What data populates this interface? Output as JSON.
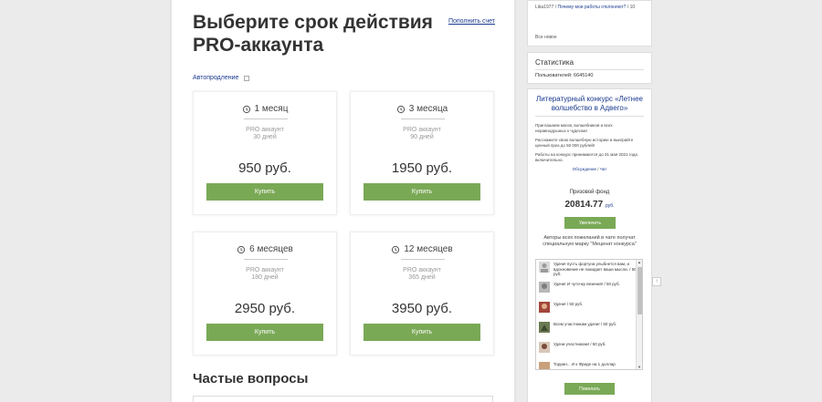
{
  "page": {
    "title": "Выберите срок действия PRO-аккаунта",
    "topup_link": "Пополнить счет",
    "autorenew_label": "Автопродление",
    "faq_title": "Частые вопросы"
  },
  "plans": [
    {
      "duration": "1 месяц",
      "type": "PRO аккаунт",
      "days": "30 дней",
      "price": "950 руб.",
      "buy_label": "Купить"
    },
    {
      "duration": "3 месяца",
      "type": "PRO аккаунт",
      "days": "90 дней",
      "price": "1950 руб.",
      "buy_label": "Купить"
    },
    {
      "duration": "6 месяцев",
      "type": "PRO аккаунт",
      "days": "180 дней",
      "price": "2950 руб.",
      "buy_label": "Купить"
    },
    {
      "duration": "12 месяцев",
      "type": "PRO аккаунт",
      "days": "365 дней",
      "price": "3950 руб.",
      "buy_label": "Купить"
    }
  ],
  "sidebar": {
    "news": {
      "author": "Lika1977",
      "sep1": "/",
      "link": "Почему мои работы отклоняют?",
      "sep2": "/",
      "count": "10",
      "all_news": "Все новое"
    },
    "stats": {
      "title": "Статистика",
      "users": "Пользователей: 6645140"
    },
    "contest": {
      "title": "Литературный конкурс «Летнее волшебство в Адвего»",
      "p1": "Приглашаем магов, волшебников и всех неравнодушных к чудесам!",
      "p2": "Расскажите свою волшебную историю и выиграйте ценный приз до 50 000 рублей!",
      "p3": "Работы на конкурс принимаются до 31 мая 2021 года включительно.",
      "discussion": "Обсуждение",
      "sep": "/",
      "chat": "Чат",
      "prize_label": "Призовой фонд",
      "prize_value": "20814.77",
      "prize_currency": "руб.",
      "increase_label": "Увеличить",
      "authors_note": "Авторы всех пожеланий в чате получат специальную марку \"Меценат конкурса\"",
      "wishes": [
        {
          "text": "Удачи! пусть фортуна улыбнется вам, и вдохновение не покидает ваши мысли. / 50 руб."
        },
        {
          "text": "Удачи! И чуточку везения! / 50 руб."
        },
        {
          "text": "Удачи! / 50 руб."
        },
        {
          "text": "Всем участникам удачи! / 50 руб."
        },
        {
          "text": "Удачи участникам! / 50 руб."
        },
        {
          "text": "Торрин... И к Фриде на 1 доллар"
        }
      ],
      "wish_button": "Пожелать"
    }
  },
  "colors": {
    "accent_green": "#7aa956",
    "link_blue": "#1a3a8f"
  }
}
